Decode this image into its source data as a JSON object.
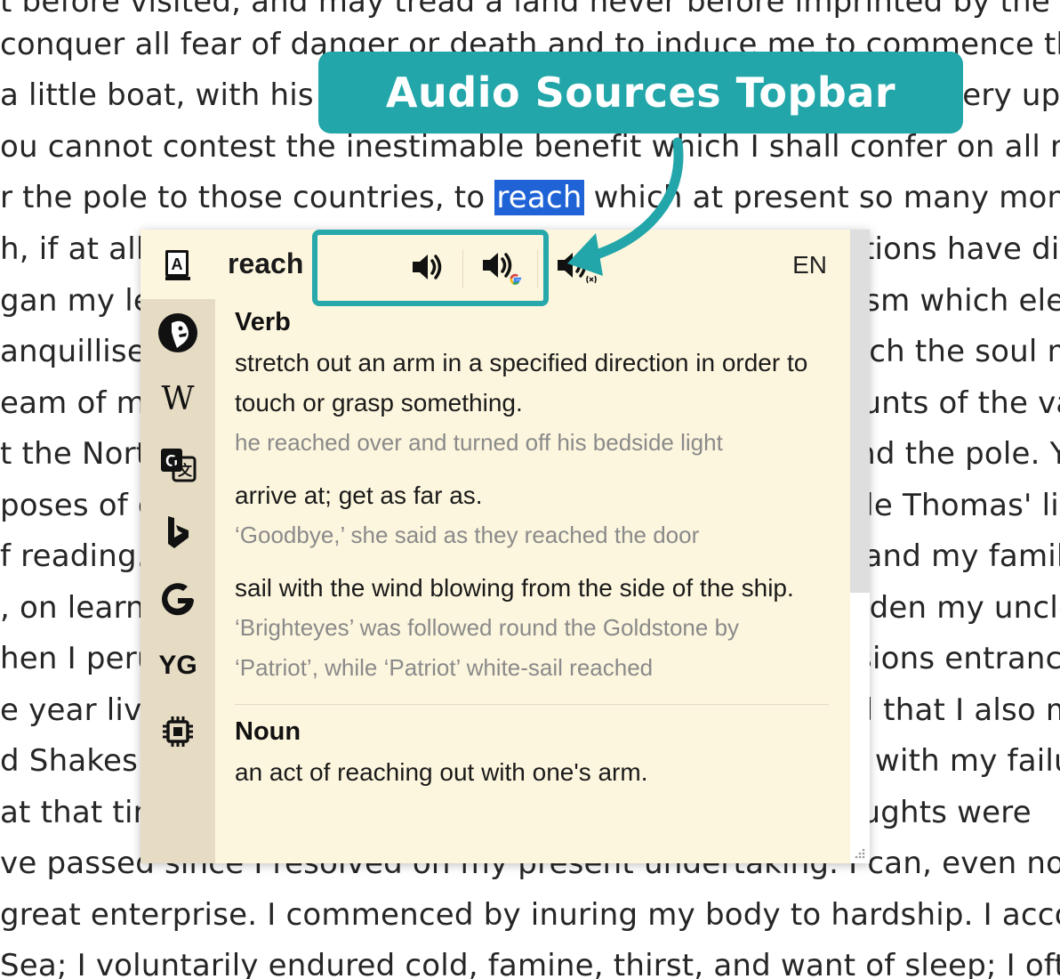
{
  "background_text": [
    {
      "text": "t before visited, and may tread a land never before imprinted by the foot of",
      "highlight": ""
    },
    {
      "text": "conquer all fear of danger or death and to induce me to commence this labo",
      "highlight": ""
    },
    {
      "text": "a little boat, with his holiday mates, on an expedition of discovery up his nati",
      "highlight": ""
    },
    {
      "text": "ou cannot contest the inestimable benefit which I shall confer on all mankin",
      "highlight": ""
    },
    {
      "text": "r the pole to those countries, to ",
      "highlight": "reach",
      "after": " which at present so many months are"
    },
    {
      "text": "h, if at all, by an undertaking such as mine. These reflections have dispelled",
      "highlight": ""
    },
    {
      "text": "gan my letter, and I feel my heart glow with an enthusiasm which elevates",
      "highlight": ""
    },
    {
      "text": "anquillise the mind as a steady purpose,—a point on which the soul may fix it",
      "highlight": ""
    },
    {
      "text": "eam of my early years. I have read with ardour the accounts of the various v",
      "highlight": ""
    },
    {
      "text": "t the North Pacific Ocean through the seas which surround the pole. You m",
      "highlight": ""
    },
    {
      "text": "poses of discovery composed the whole of our good Uncle Thomas' library.",
      "highlight": ""
    },
    {
      "text": "f reading. These volumes were my study day and night, and my familiarity",
      "highlight": ""
    },
    {
      "text": ", on learning that my father's dying injunction had forbidden my uncle to a",
      "highlight": ""
    },
    {
      "text": "hen I perused, for the first time, those poets whose effusions entranced my",
      "highlight": ""
    },
    {
      "text": "e year lived in a paradise of my own creation; I imagined that I also might o",
      "highlight": ""
    },
    {
      "text": "d Shakespeare are consecrated. You are well acquainted with my failu",
      "highlight": ""
    },
    {
      "text": "at that time I inherited the fortune of my cousin, my thoughts were",
      "highlight": ""
    },
    {
      "text": "ve passed since I resolved on my present undertaking. I can, even now, r",
      "highlight": ""
    },
    {
      "text": "great enterprise. I commenced by inuring my body to hardship. I accompa",
      "highlight": ""
    },
    {
      "text": "Sea; I voluntarily endured cold, famine, thirst, and want of sleep; I often w",
      "highlight": ""
    }
  ],
  "popup": {
    "word": "reach",
    "language": "EN",
    "sidebar_icons": [
      "dictionary-icon",
      "duckduckgo-icon",
      "wikipedia-icon",
      "google-translate-icon",
      "bing-icon",
      "google-icon",
      "youglish-icon",
      "chip-icon"
    ],
    "sidebar_glyphs": {
      "wikipedia": "W",
      "youglish": "YG"
    },
    "audio_buttons": [
      "speaker-icon",
      "speaker-google-icon",
      "speaker-x-icon"
    ],
    "sections": [
      {
        "pos": "Verb",
        "items": [
          {
            "def": "stretch out an arm in a specified direction in order to touch or grasp something.",
            "ex": "he reached over and turned off his bedside light"
          },
          {
            "def": "arrive at; get as far as.",
            "ex": "‘Goodbye,’ she said as they reached the door"
          },
          {
            "def": "sail with the wind blowing from the side of the ship.",
            "ex": "‘Brighteyes’ was followed round the Goldstone by ‘Patriot’, while ‘Patriot’ white-sail reached"
          }
        ]
      },
      {
        "pos": "Noun",
        "items": [
          {
            "def": "an act of reaching out with one's arm.",
            "ex": ""
          }
        ]
      }
    ]
  },
  "annotation": {
    "title": "Audio Sources Topbar",
    "color": "#22a6a9"
  }
}
